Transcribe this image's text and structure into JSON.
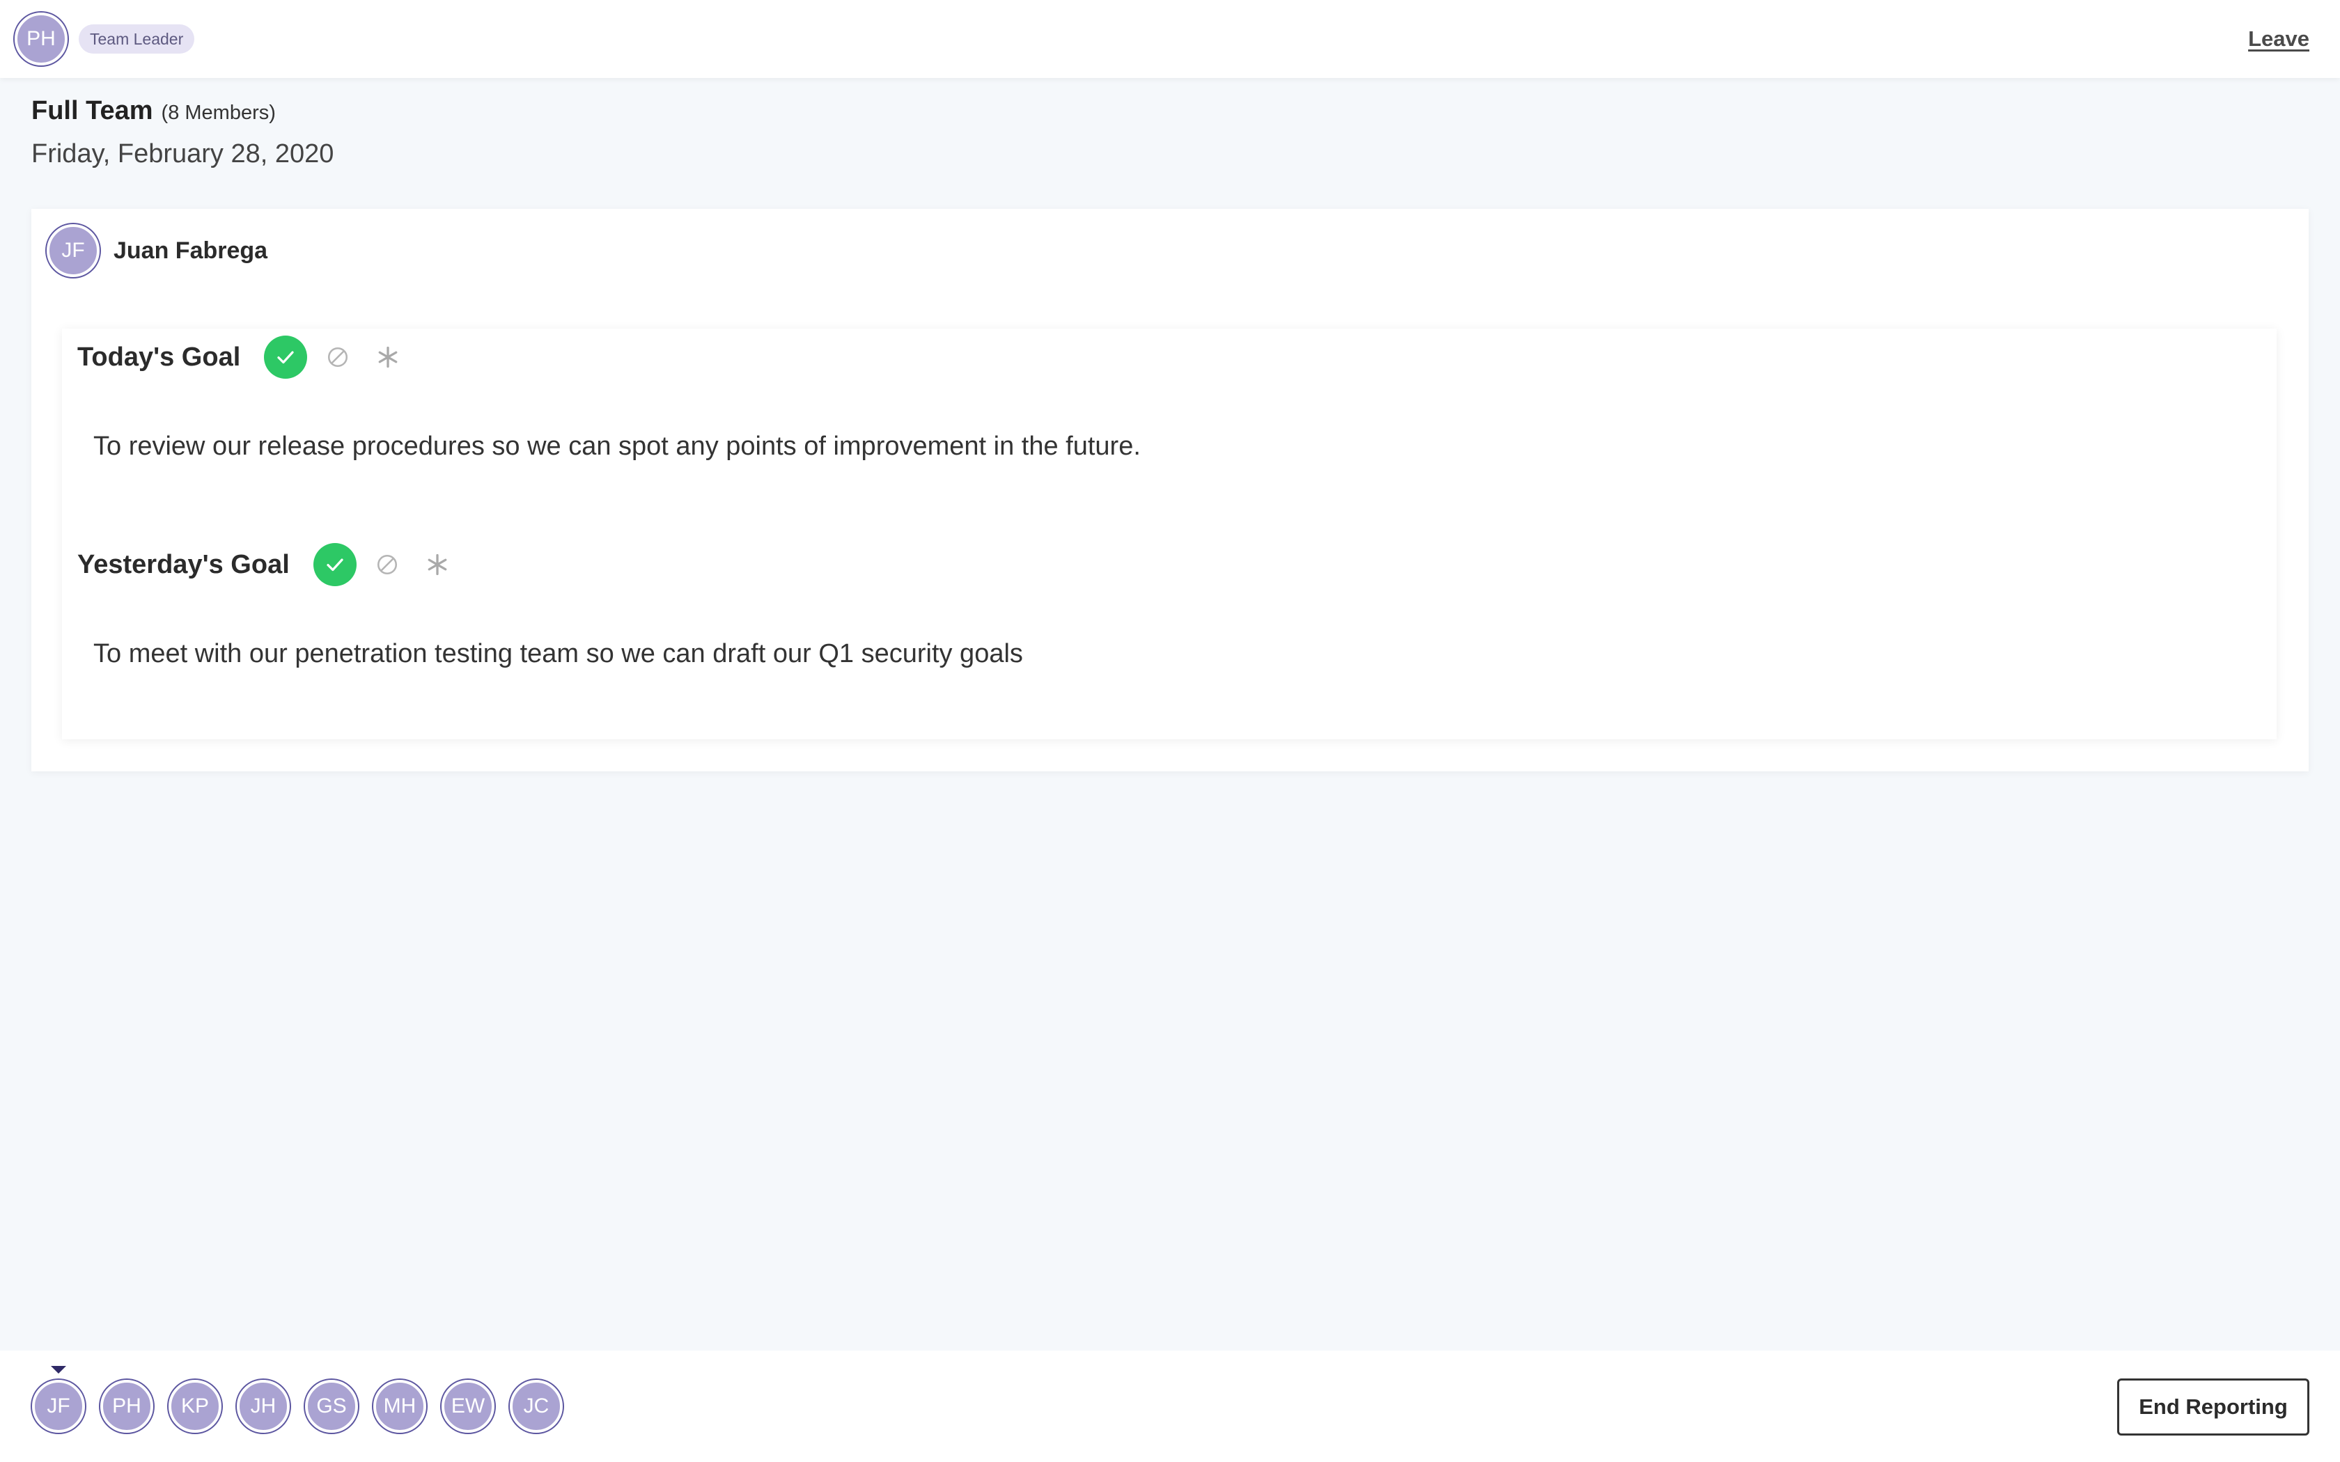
{
  "header": {
    "user_initials": "PH",
    "role_badge": "Team Leader",
    "leave_label": "Leave"
  },
  "team": {
    "name": "Full Team",
    "members_count": "(8 Members)",
    "date": "Friday, February 28, 2020"
  },
  "member": {
    "initials": "JF",
    "name": "Juan Fabrega",
    "today": {
      "title": "Today's Goal",
      "text": "To review our release procedures so we can spot any points of improvement in the future.",
      "status": "done"
    },
    "yesterday": {
      "title": "Yesterday's Goal",
      "text": "To meet with our penetration testing team so we can draft our Q1 security goals",
      "status": "done"
    }
  },
  "bottom": {
    "members": [
      {
        "initials": "JF",
        "current": true
      },
      {
        "initials": "PH",
        "current": false
      },
      {
        "initials": "KP",
        "current": false
      },
      {
        "initials": "JH",
        "current": false
      },
      {
        "initials": "GS",
        "current": false
      },
      {
        "initials": "MH",
        "current": false
      },
      {
        "initials": "EW",
        "current": false
      },
      {
        "initials": "JC",
        "current": false
      }
    ],
    "end_label": "End Reporting"
  },
  "icons": {
    "done": "check-icon",
    "blocked": "blocked-icon",
    "other": "asterisk-icon"
  },
  "colors": {
    "avatar_bg": "#aaa3d2",
    "avatar_ring": "#5c56a0",
    "done_green": "#2dc865",
    "badge_bg": "#e6e3f4",
    "page_bg": "#f5f8fb"
  }
}
